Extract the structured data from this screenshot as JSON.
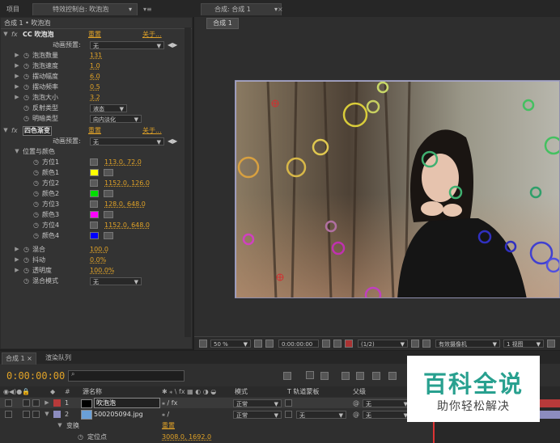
{
  "top_tabs": {
    "project": "项目",
    "effect_controls": "特效控制台: 吹泡泡",
    "composition": "合成: 合成 1"
  },
  "effect_controls": {
    "breadcrumb": "合成 1 • 吹泡泡",
    "effect1": {
      "name": "CC 吹泡泡",
      "reset": "重置",
      "about": "关于...",
      "preset_label": "动画预置:",
      "preset_value": "无",
      "params": [
        {
          "label": "泡泡数量",
          "value": "131"
        },
        {
          "label": "泡泡速度",
          "value": "1.0"
        },
        {
          "label": "摆动幅度",
          "value": "6.0"
        },
        {
          "label": "摆动频率",
          "value": "0.5"
        },
        {
          "label": "泡泡大小",
          "value": "3.2"
        }
      ],
      "reflection_label": "反射类型",
      "reflection_value": "液态",
      "shading_label": "明暗类型",
      "shading_value": "向内淡化"
    },
    "effect2": {
      "name": "四色渐变",
      "reset": "重置",
      "about": "关于...",
      "preset_label": "动画预置:",
      "preset_value": "无",
      "group_label": "位置与颜色",
      "points": [
        {
          "label": "方位1",
          "value": "113.0, 72.0"
        },
        {
          "label": "颜色1",
          "color": "#ffff00"
        },
        {
          "label": "方位2",
          "value": "1152.0, 126.0"
        },
        {
          "label": "颜色2",
          "color": "#00e000"
        },
        {
          "label": "方位3",
          "value": "128.0, 648.0"
        },
        {
          "label": "颜色3",
          "color": "#ff00ff"
        },
        {
          "label": "方位4",
          "value": "1152.0, 648.0"
        },
        {
          "label": "颜色4",
          "color": "#0000ff"
        }
      ],
      "blend_label": "混合",
      "blend_value": "100.0",
      "jitter_label": "抖动",
      "jitter_value": "0.0%",
      "opacity_label": "透明度",
      "opacity_value": "100.0%",
      "mode_label": "混合模式",
      "mode_value": "无"
    }
  },
  "viewer": {
    "comp_tab": "合成 1",
    "zoom": "50 %",
    "timecode": "0:00:00:00",
    "resolution": "(1/2)",
    "camera": "有效摄像机",
    "views": "1 视图"
  },
  "timeline": {
    "tab_comp": "合成 1",
    "tab_render": "渲染队列",
    "timecode": "0:00:00:00",
    "col_source": "源名称",
    "col_mode": "模式",
    "col_trkmat": "T  轨道蒙板",
    "col_parent": "父级",
    "layers": [
      {
        "num": "1",
        "name": "吹泡泡",
        "mode": "正常",
        "parent": "无",
        "color": "#b83a3a"
      },
      {
        "num": "2",
        "name": "500205094.jpg",
        "mode": "正常",
        "trkmat": "无",
        "parent": "无",
        "color": "#8c8cbf"
      }
    ],
    "transform_label": "变换",
    "transform_reset": "重置",
    "anchor_label": "定位点",
    "anchor_value": "3008.0, 1692.0"
  },
  "watermark": {
    "title": "百科全说",
    "subtitle": "助你轻松解决"
  },
  "colors": {
    "accent_value": "#e0a227",
    "panel": "#333333",
    "watermark_green": "#28a08f"
  }
}
